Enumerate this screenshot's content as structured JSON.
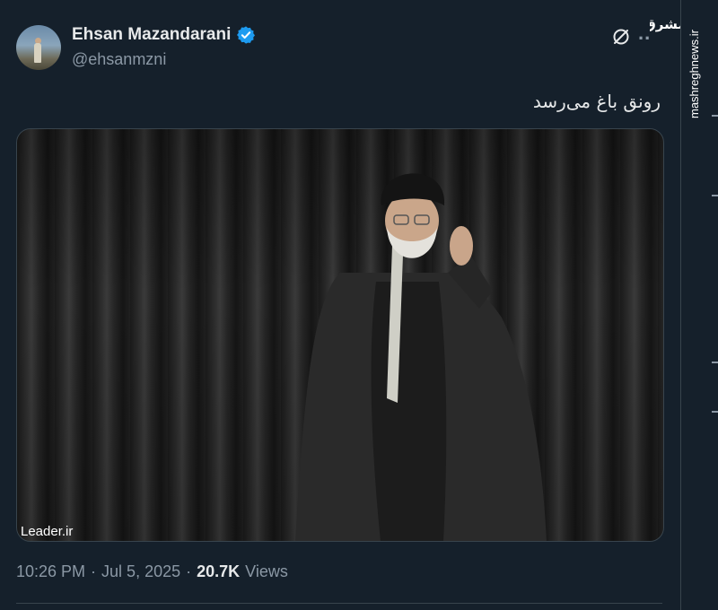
{
  "author": {
    "display_name": "Ehsan Mazandarani",
    "handle": "@ehsanmzni",
    "verified_color": "#1d9bf0"
  },
  "actions": {
    "more_label": ".."
  },
  "watermark": {
    "logo_text": "مشرق",
    "site": "mashreghnews.ir"
  },
  "tweet": {
    "text": "رونق باغ می‌رسد"
  },
  "media": {
    "credit": "Leader.ir"
  },
  "meta": {
    "time": "10:26 PM",
    "date": "Jul 5, 2025",
    "views_count": "20.7K",
    "views_label": "Views",
    "separator": "·"
  },
  "colors": {
    "background": "#15202b",
    "text_primary": "#e7e9ea",
    "text_secondary": "#8b98a5",
    "border": "#38444d"
  }
}
